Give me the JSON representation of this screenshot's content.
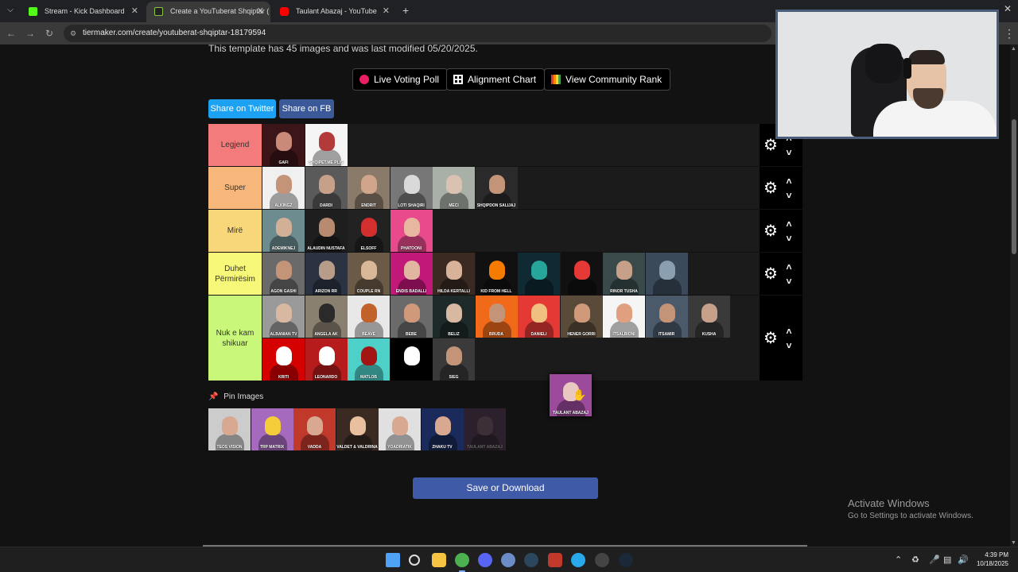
{
  "browser": {
    "tabs": [
      {
        "title": "Stream - Kick Dashboard",
        "favicon_color": "#53fc18"
      },
      {
        "title": "Create a YouTuberat Shqiptar (",
        "favicon_color": "#222222"
      },
      {
        "title": "Taulant Abazaj - YouTube",
        "favicon_color": "#ff0000"
      }
    ],
    "url": "tiermaker.com/create/youtuberat-shqiptar-18179594",
    "new_tab": "+",
    "icons": {
      "back": "back-arrow-icon",
      "forward": "forward-arrow-icon",
      "reload": "reload-icon",
      "site_info": "site-info-icon",
      "menu": "kebab-menu-icon"
    }
  },
  "page": {
    "template_info": "This template has 45 images and was last modified 05/20/2025.",
    "buttons": {
      "live_voting": "Live Voting Poll",
      "alignment": "Alignment Chart",
      "community": "View Community Rank"
    },
    "share": {
      "twitter": "Share on Twitter",
      "fb": "Share on FB",
      "twitter_color": "#1da1f2",
      "fb_color": "#3b5998"
    },
    "tiers": [
      {
        "label": "Legjend",
        "color": "#f47b7b",
        "items": [
          {
            "caption": "GAFI",
            "bg": "#3b1518",
            "skin": "#c98a7a"
          },
          {
            "caption": "SHQIPET.ME PLIS",
            "bg": "#f5f5f5",
            "skin": "#b23a3a"
          }
        ]
      },
      {
        "label": "Super",
        "color": "#f7b77a",
        "items": [
          {
            "caption": "ALKINGZ",
            "bg": "#f0f0f0",
            "skin": "#c49478"
          },
          {
            "caption": "DARDI",
            "bg": "#5a5a5a",
            "skin": "#c7a08a"
          },
          {
            "caption": "ENDRIT",
            "bg": "#8a7a6a",
            "skin": "#d1a589"
          },
          {
            "caption": "LOTI SHAQIRI",
            "bg": "#777777",
            "skin": "#d9d9d9"
          },
          {
            "caption": "MECI",
            "bg": "#a8b0a8",
            "skin": "#d9c2b0"
          },
          {
            "caption": "SHQIPDON SALIJAJ",
            "bg": "#2a2a2a",
            "skin": "#c49478"
          }
        ]
      },
      {
        "label": "Mirë",
        "color": "#f7d77a",
        "items": [
          {
            "caption": "ADEMIKNEJ",
            "bg": "#6c8c8f",
            "skin": "#d1b097"
          },
          {
            "caption": "ALAUDIN NUSTAFA",
            "bg": "#1e1e1e",
            "skin": "#b88a70"
          },
          {
            "caption": "ELSOFF",
            "bg": "#222222",
            "skin": "#d32f2f"
          },
          {
            "caption": "PHATOONI",
            "bg": "#e84a8c",
            "skin": "#e8b7a0"
          }
        ]
      },
      {
        "label": "Duhet Përmirësim",
        "color": "#f7f77a",
        "items": [
          {
            "caption": "AGON GASHI",
            "bg": "#6a6a6a",
            "skin": "#c49478"
          },
          {
            "caption": "ARIZON RR",
            "bg": "#2b3342",
            "skin": "#b89c8a"
          },
          {
            "caption": "COUPLE RN",
            "bg": "#6b5a45",
            "skin": "#d9b89a"
          },
          {
            "caption": "ENDIS BADALLI",
            "bg": "#c2187a",
            "skin": "#e0b6a0"
          },
          {
            "caption": "HILDA KERTALLI",
            "bg": "#3a2a22",
            "skin": "#d8b39a"
          },
          {
            "caption": "KID FROM HELL",
            "bg": "#111111",
            "skin": "#f57c00"
          },
          {
            "caption": "",
            "bg": "#0f2a33",
            "skin": "#26a69a"
          },
          {
            "caption": "",
            "bg": "#111111",
            "skin": "#e53935"
          },
          {
            "caption": "RINOR TUSHA",
            "bg": "#3a4a4a",
            "skin": "#c7a08a"
          },
          {
            "caption": "",
            "bg": "#3a4a5a",
            "skin": "#8aa0b0"
          }
        ]
      },
      {
        "label": "Nuk e kam shikuar",
        "color": "#c8f77a",
        "items": [
          {
            "caption": "ALBANIAN TV",
            "bg": "#9a9a9a",
            "skin": "#d8b8a0"
          },
          {
            "caption": "ANGELA AK",
            "bg": "#8a8070",
            "skin": "#2a2a2a"
          },
          {
            "caption": "BEAVE",
            "bg": "#e8e8e8",
            "skin": "#c0622a"
          },
          {
            "caption": "BEBE",
            "bg": "#6a6a6a",
            "skin": "#d09a7a"
          },
          {
            "caption": "BELIZ",
            "bg": "#1e2a2a",
            "skin": "#d8b8a0"
          },
          {
            "caption": "BRUDA",
            "bg": "#f06a1a",
            "skin": "#c49478"
          },
          {
            "caption": "DANIELI",
            "bg": "#e53935",
            "skin": "#f0c080"
          },
          {
            "caption": "HENER GORRI",
            "bg": "#5a4a3a",
            "skin": "#d09a7a"
          },
          {
            "caption": "ITSALBIONI",
            "bg": "#f5f5f5",
            "skin": "#e0a080"
          },
          {
            "caption": "ITSAMIR",
            "bg": "#4a5a6a",
            "skin": "#c49478"
          },
          {
            "caption": "KUSHA",
            "bg": "#3a3a3a",
            "skin": "#c7a08a"
          },
          {
            "caption": "KRITI",
            "bg": "#d50000",
            "skin": "#ffffff"
          },
          {
            "caption": "LEONARDO",
            "bg": "#b71c1c",
            "skin": "#ffffff"
          },
          {
            "caption": "MATLOB",
            "bg": "#4dd0c8",
            "skin": "#a31515"
          },
          {
            "caption": "",
            "bg": "#000000",
            "skin": "#ffffff"
          },
          {
            "caption": "SIEG",
            "bg": "#3a3a3a",
            "skin": "#c49478"
          }
        ]
      }
    ],
    "pin_label": "Pin Images",
    "pool": [
      {
        "caption": "TEOS VISION",
        "bg": "#cccccc",
        "skin": "#d8a890"
      },
      {
        "caption": "TRP MATRIX",
        "bg": "#a569bd",
        "skin": "#f5cc3a"
      },
      {
        "caption": "VADDA",
        "bg": "#c0392b",
        "skin": "#d8a890"
      },
      {
        "caption": "VALDET & VALDRINA",
        "bg": "#3a2a22",
        "skin": "#e8c0a0"
      },
      {
        "caption": "YOADRIATIK",
        "bg": "#e0e0e0",
        "skin": "#d8a890"
      },
      {
        "caption": "ZHAKU TV",
        "bg": "#1a2a5a",
        "skin": "#d8a890"
      },
      {
        "caption": "TAULANT ABAZAJ",
        "bg": "#5a3a5a",
        "skin": "#8a6a7a"
      }
    ],
    "dragged": {
      "caption": "TAULANT ABAZAJ",
      "bg": "#9c4a9c",
      "skin": "#e8c8c0"
    },
    "save": "Save or Download",
    "activate_windows": {
      "line1": "Activate Windows",
      "line2": "Go to Settings to activate Windows."
    }
  },
  "taskbar": {
    "icons": [
      {
        "name": "windows-start-icon",
        "color": "#4fa3f7"
      },
      {
        "name": "search-icon",
        "color": "#dddddd"
      },
      {
        "name": "file-explorer-icon",
        "color": "#f5c242"
      },
      {
        "name": "chrome-icon",
        "color": "#4caf50"
      },
      {
        "name": "discord-icon",
        "color": "#5865f2"
      },
      {
        "name": "app-circle-icon",
        "color": "#6b8cc7"
      },
      {
        "name": "steam-icon",
        "color": "#2a475e"
      },
      {
        "name": "shield-app-icon",
        "color": "#c0392b"
      },
      {
        "name": "telegram-icon",
        "color": "#29a9eb"
      },
      {
        "name": "obs-icon",
        "color": "#444444"
      },
      {
        "name": "steam-icon-2",
        "color": "#1b2838"
      }
    ],
    "time": "4:39 PM",
    "date": "10/18/2025"
  }
}
